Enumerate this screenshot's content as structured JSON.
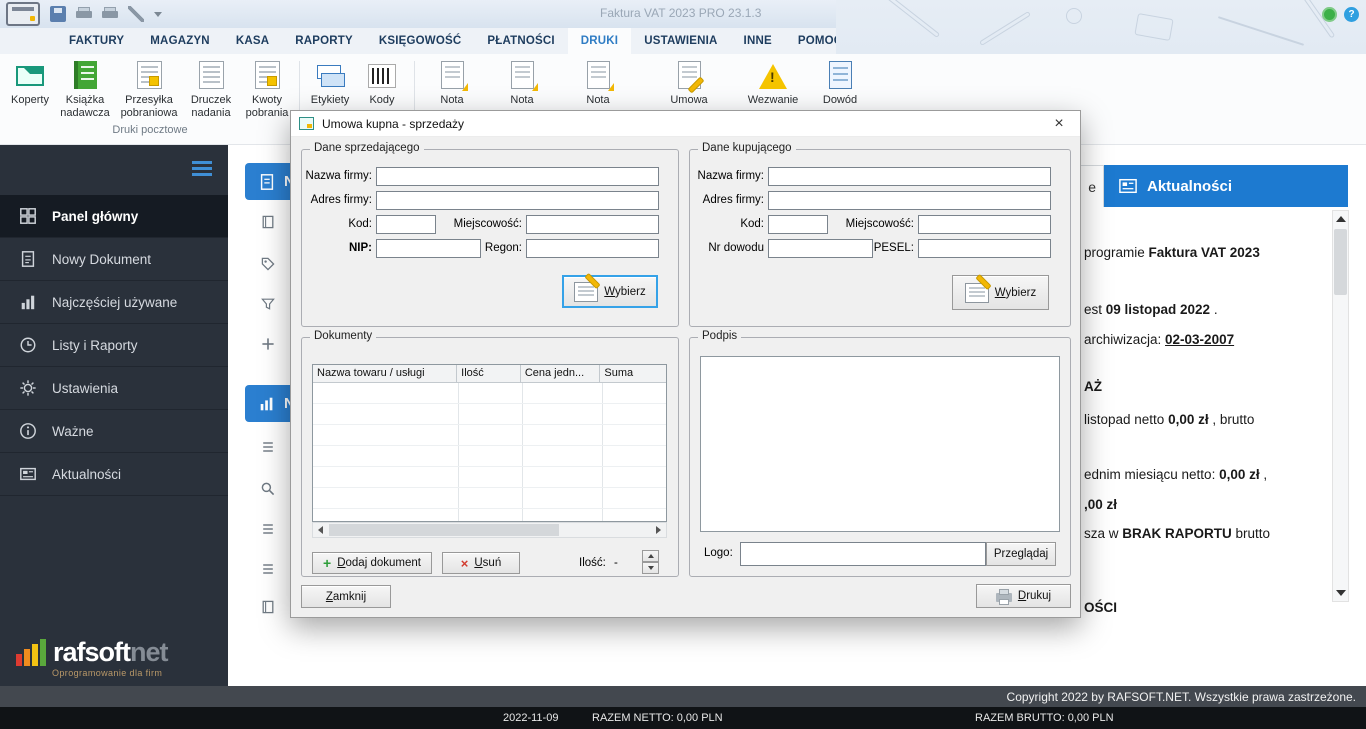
{
  "palette": {
    "accent_blue": "#1d7ad0",
    "titlebar_bg": "#dde7f1",
    "sidebar_bg": "#2a313b",
    "sidebar_active_bg": "#151b23",
    "warning_yellow": "#f5c400",
    "statusbar_bg": "#101316"
  },
  "titlebar": {
    "title": "Faktura VAT 2023 PRO 23.1.3"
  },
  "menu": {
    "tabs": [
      {
        "label": "FAKTURY"
      },
      {
        "label": "MAGAZYN"
      },
      {
        "label": "KASA"
      },
      {
        "label": "RAPORTY"
      },
      {
        "label": "KSIĘGOWOŚĆ"
      },
      {
        "label": "PŁATNOŚCI"
      },
      {
        "label": "DRUKI",
        "active": true
      },
      {
        "label": "USTAWIENIA"
      },
      {
        "label": "INNE"
      },
      {
        "label": "POMOC"
      }
    ]
  },
  "ribbon": {
    "group_label": "Druki pocztowe",
    "items": [
      "Koperty",
      "Książka nadawcza",
      "Przesyłka pobraniowa",
      "Druczek nadania",
      "Kwoty pobrania",
      "Etykiety",
      "Kody",
      "Nota",
      "Nota",
      "Nota",
      "Umowa",
      "Wezwanie",
      "Dowód"
    ]
  },
  "sidebar": {
    "items": [
      {
        "label": "Panel główny",
        "active": true
      },
      {
        "label": "Nowy Dokument"
      },
      {
        "label": "Najczęściej używane"
      },
      {
        "label": "Listy i Raporty"
      },
      {
        "label": "Ustawienia"
      },
      {
        "label": "Ważne"
      },
      {
        "label": "Aktualności"
      }
    ],
    "logo": {
      "name1": "rafsoft",
      "name2": "net",
      "tagline": "Oprogramowanie dla firm"
    }
  },
  "content": {
    "panel1_visible_label": "N",
    "panel2_visible_label": "N",
    "left_tab_visible_label": "e"
  },
  "news": {
    "tab_label": "Aktualności",
    "lines": [
      {
        "pre": "programie ",
        "bold": "Faktura VAT 2023",
        "post": ""
      },
      {
        "pre": "est ",
        "bold": "09 listopad 2022",
        "post": " ."
      },
      {
        "pre": "archiwizacja: ",
        "bold": "02-03-2007",
        "post": ""
      },
      {
        "pre": "",
        "bold": "AŻ",
        "post": ""
      },
      {
        "pre": "listopad netto ",
        "bold": "0,00 zł",
        "post": " , brutto"
      },
      {
        "pre": "ednim miesiącu netto: ",
        "bold": "0,00 zł",
        "post": " ,"
      },
      {
        "pre": "",
        "bold": ",00 zł",
        "post": ""
      },
      {
        "pre": "sza w ",
        "bold": "BRAK RAPORTU",
        "post": " brutto"
      },
      {
        "pre": "",
        "bold": "OŚCI",
        "post": ""
      }
    ]
  },
  "dialog": {
    "title": "Umowa kupna - sprzedaży",
    "seller": {
      "legend": "Dane sprzedającego",
      "fields": {
        "nazwa": {
          "label": "Nazwa firmy:",
          "value": ""
        },
        "adres": {
          "label": "Adres firmy:",
          "value": ""
        },
        "kod": {
          "label": "Kod:",
          "value": ""
        },
        "miejscowosc": {
          "label": "Miejscowość:",
          "value": ""
        },
        "nip": {
          "label": "NIP:",
          "value": ""
        },
        "regon": {
          "label": "Regon:",
          "value": ""
        }
      },
      "choose_button": {
        "key": "W",
        "rest": "ybierz"
      }
    },
    "buyer": {
      "legend": "Dane kupującego",
      "fields": {
        "nazwa": {
          "label": "Nazwa firmy:",
          "value": ""
        },
        "adres": {
          "label": "Adres firmy:",
          "value": ""
        },
        "kod": {
          "label": "Kod:",
          "value": ""
        },
        "miejscowosc": {
          "label": "Miejscowość:",
          "value": ""
        },
        "nr_dowodu": {
          "label": "Nr dowodu",
          "value": ""
        },
        "pesel": {
          "label": "PESEL:",
          "value": ""
        }
      },
      "choose_button": {
        "key": "W",
        "rest": "ybierz"
      }
    },
    "documents": {
      "legend": "Dokumenty",
      "columns": [
        "Nazwa towaru / usługi",
        "Ilość",
        "Cena jedn...",
        "Suma"
      ],
      "rows": [],
      "add_button": {
        "key": "D",
        "rest": "odaj dokument"
      },
      "remove_button": {
        "key": "U",
        "rest": "suń"
      },
      "qty_label": "Ilość:",
      "qty_value": "-"
    },
    "signature": {
      "legend": "Podpis",
      "logo_label": "Logo:",
      "logo_value": "",
      "browse_button": "Przeglądaj"
    },
    "close_button": {
      "key": "Z",
      "rest": "amknij"
    },
    "print_button": {
      "key": "D",
      "rest": "rukuj"
    }
  },
  "footer": {
    "copyright": "Copyright 2022 by RAFSOFT.NET. Wszystkie prawa zastrzeżone.",
    "date": "2022-11-09",
    "netto": "RAZEM NETTO: 0,00 PLN",
    "brutto": "RAZEM BRUTTO: 0,00 PLN"
  }
}
